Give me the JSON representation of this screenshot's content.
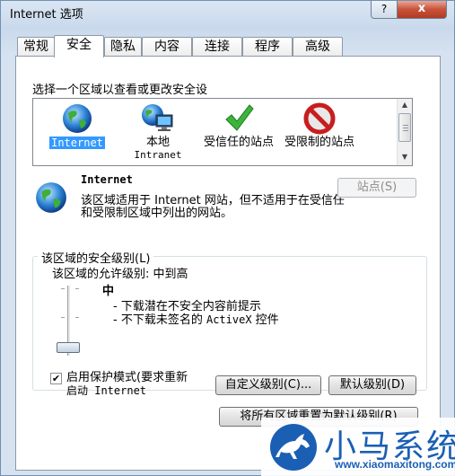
{
  "window": {
    "title": "Internet 选项",
    "help_label": "?",
    "close_label": "x"
  },
  "tabs": [
    {
      "label": "常规"
    },
    {
      "label": "安全",
      "active": true
    },
    {
      "label": "隐私"
    },
    {
      "label": "内容"
    },
    {
      "label": "连接"
    },
    {
      "label": "程序"
    },
    {
      "label": "高级"
    }
  ],
  "security": {
    "prompt": "选择一个区域以查看或更改安全设",
    "zones": [
      {
        "label": "Internet",
        "selected": true,
        "icon": "globe-icon"
      },
      {
        "label": "本地",
        "sub": "Intranet",
        "icon": "local-intranet-icon"
      },
      {
        "label": "受信任的站点",
        "icon": "check-icon"
      },
      {
        "label": "受限制的站点",
        "icon": "no-entry-icon"
      }
    ],
    "selected_zone_name": "Internet",
    "selected_zone_desc": "该区域适用于 Internet 网站，但不适用于在受信任和受限制区域中列出的网站。",
    "sites_button": "站点(S)",
    "level_group_title": "该区域的安全级别(L)",
    "allowed_levels": "该区域的允许级别: 中到高",
    "level_name": "中",
    "level_desc_1": "- 下载潜在不安全内容前提示",
    "level_desc_2_pre": "- 不下载未签名的 ",
    "level_desc_2_en": "ActiveX",
    "level_desc_2_post": " 控件",
    "slider_level": 0.9,
    "protected_mode_checked": true,
    "protected_mode_label_1": "启用保护模式(要求重新",
    "protected_mode_label_2": "启动 Internet",
    "custom_level_button": "自定义级别(C)...",
    "default_level_button": "默认级别(D)",
    "reset_all_button": "将所有区域重置为默认级别(R)"
  },
  "watermark": {
    "brand": "小马系统",
    "url": "www.xiaomaxitong.com",
    "icon": "horse-logo-icon"
  },
  "colors": {
    "selection": "#3399ff",
    "watermark": "#1a5fb4"
  }
}
